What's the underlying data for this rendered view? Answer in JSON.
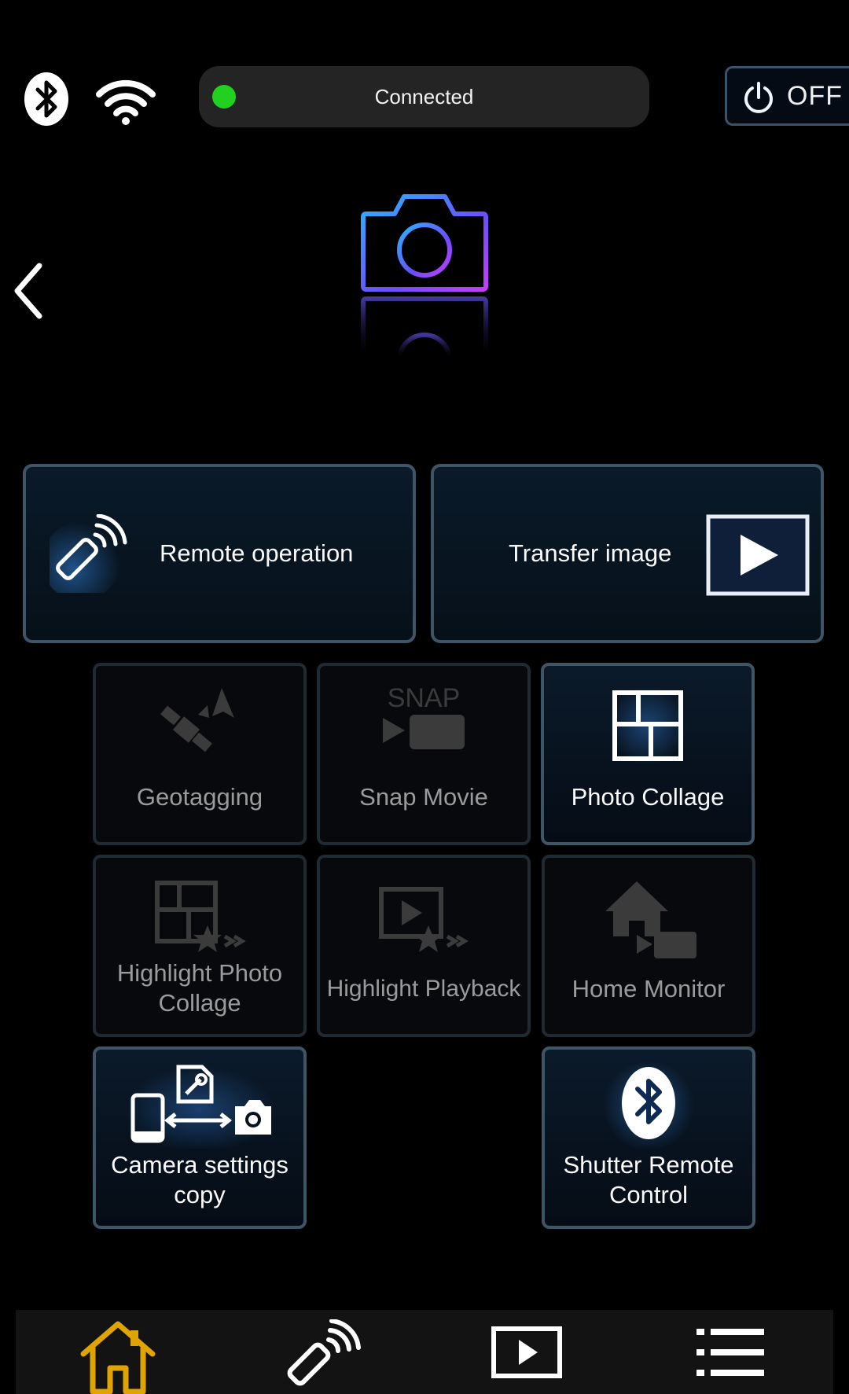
{
  "status": {
    "connection_text": "Connected",
    "connection_color": "#22d11f",
    "power_label": "OFF",
    "icons": [
      "bluetooth-icon",
      "wifi-icon",
      "power-icon"
    ]
  },
  "header": {
    "back_icon": "chevron-left-icon",
    "device_icon": "camera-icon"
  },
  "main_buttons": {
    "remote": {
      "label": "Remote operation",
      "icon": "remote-control-icon"
    },
    "transfer": {
      "label": "Transfer image",
      "icon": "play-icon"
    }
  },
  "tiles": {
    "geotagging": {
      "label": "Geotagging",
      "icon": "satellite-icon",
      "enabled": false
    },
    "snap_movie": {
      "label": "Snap Movie",
      "icon": "snap-movie-icon",
      "icon_text": "SNAP",
      "enabled": false
    },
    "photo_collage": {
      "label": "Photo Collage",
      "icon": "collage-icon",
      "enabled": true
    },
    "highlight_collage": {
      "line1": "Highlight Photo",
      "line2": "Collage",
      "icon": "highlight-collage-icon",
      "enabled": false
    },
    "highlight_playback": {
      "label": "Highlight Playback",
      "icon": "highlight-playback-icon",
      "enabled": false
    },
    "home_monitor": {
      "label": "Home Monitor",
      "icon": "home-monitor-icon",
      "enabled": false
    },
    "settings_copy": {
      "line1": "Camera settings",
      "line2": "copy",
      "icon": "settings-copy-icon",
      "enabled": true
    },
    "shutter_remote": {
      "line1": "Shutter Remote",
      "line2": "Control",
      "icon": "bluetooth-icon",
      "enabled": true
    }
  },
  "bottom_nav": [
    {
      "name": "home",
      "icon": "home-icon",
      "active": true
    },
    {
      "name": "remote",
      "icon": "remote-control-icon",
      "active": false
    },
    {
      "name": "playback",
      "icon": "play-icon",
      "active": false
    },
    {
      "name": "menu",
      "icon": "menu-icon",
      "active": false
    }
  ],
  "colors": {
    "accent_active_border": "#3d5565",
    "home_icon": "#e0a400",
    "camera_gradient": [
      "#2bb5ff",
      "#7b3dff",
      "#c43dff"
    ]
  }
}
